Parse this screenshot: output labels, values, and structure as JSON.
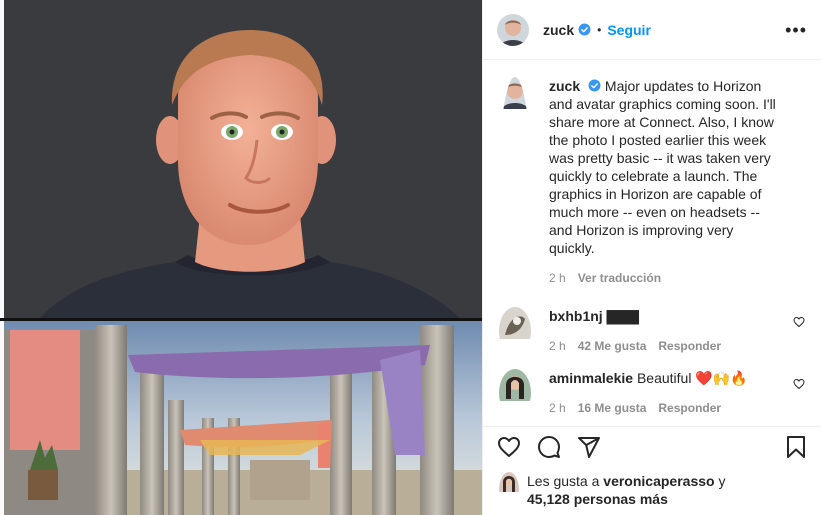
{
  "post": {
    "author": "zuck",
    "follow_label": "Seguir",
    "separator": "•",
    "more_label": "•••",
    "caption": "Major updates to Horizon and avatar graphics coming soon. I'll share more at Connect. Also, I know the photo I posted earlier this week was pretty basic -- it was taken very quickly to celebrate a launch. The graphics in Horizon are capable of much more -- even on headsets -- and Horizon is improving very quickly.",
    "time": "2 h",
    "see_translation": "Ver traducción"
  },
  "comments": [
    {
      "user": "bxhb1nj",
      "text": "▇▇▇",
      "time": "2 h",
      "likes": "42 Me gusta",
      "reply": "Responder"
    },
    {
      "user": "aminmalekie",
      "text": "Beautiful ❤️🙌🔥",
      "time": "2 h",
      "likes": "16 Me gusta",
      "reply": "Responder"
    }
  ],
  "likes": {
    "prefix": "Les gusta a",
    "user": "veronicaperasso",
    "conj": "y",
    "count_text": "45,128 personas más"
  },
  "colors": {
    "accent": "#0095f6",
    "text": "#262626",
    "muted": "#8e8e8e",
    "border": "#efefef"
  },
  "icons": [
    "verified-badge-icon",
    "heart-icon",
    "comment-icon",
    "share-icon",
    "bookmark-icon",
    "more-icon"
  ]
}
